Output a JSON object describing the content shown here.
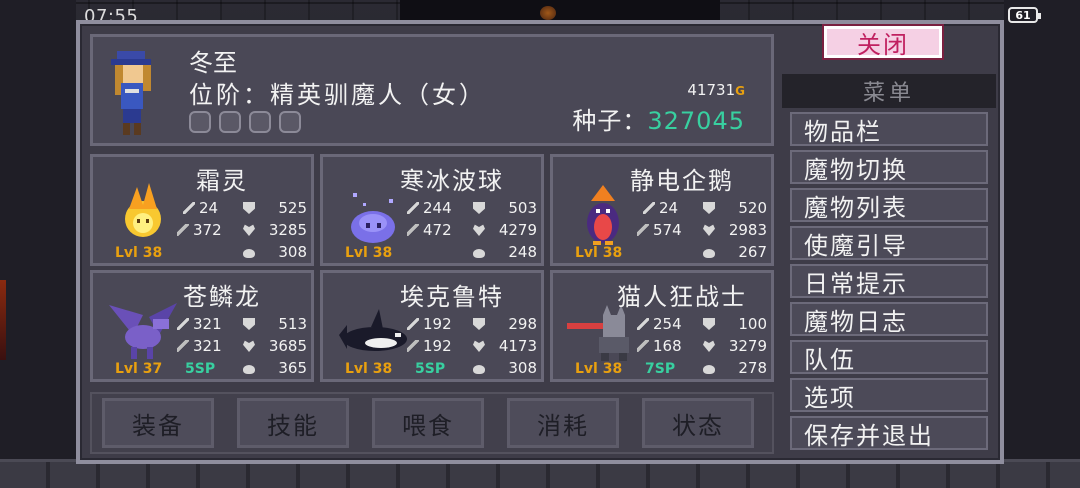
{
  "status_bar": {
    "time": "07:55",
    "battery": "61"
  },
  "hero": {
    "name": "冬至",
    "rank": "位阶：精英驯魔人（女）",
    "gold": "41731",
    "gold_unit": "G",
    "seed_label": "种子：",
    "seed_value": "327045"
  },
  "monsters": [
    {
      "name": "霜灵",
      "atk": "24",
      "def": "525",
      "mag": "372",
      "hp": "3285",
      "food": "308",
      "level": "Lvl 38",
      "sp": ""
    },
    {
      "name": "寒冰波球",
      "atk": "244",
      "def": "503",
      "mag": "472",
      "hp": "4279",
      "food": "248",
      "level": "Lvl 38",
      "sp": ""
    },
    {
      "name": "静电企鹅",
      "atk": "24",
      "def": "520",
      "mag": "574",
      "hp": "2983",
      "food": "267",
      "level": "Lvl 38",
      "sp": ""
    },
    {
      "name": "苍鳞龙",
      "atk": "321",
      "def": "513",
      "mag": "321",
      "hp": "3685",
      "food": "365",
      "level": "Lvl 37",
      "sp": "5SP"
    },
    {
      "name": "埃克鲁特",
      "atk": "192",
      "def": "298",
      "mag": "192",
      "hp": "4173",
      "food": "308",
      "level": "Lvl 38",
      "sp": "5SP"
    },
    {
      "name": "猫人狂战士",
      "atk": "254",
      "def": "100",
      "mag": "168",
      "hp": "3279",
      "food": "278",
      "level": "Lvl 38",
      "sp": "7SP"
    }
  ],
  "actions": [
    "装备",
    "技能",
    "喂食",
    "消耗",
    "状态"
  ],
  "menu": {
    "close_label": "关闭",
    "header": "菜单",
    "items": [
      "物品栏",
      "魔物切换",
      "魔物列表",
      "使魔引导",
      "日常提示",
      "魔物日志",
      "队伍",
      "选项",
      "保存并退出"
    ]
  },
  "colors": {
    "gold": "#e8a010",
    "seed": "#38d0a0",
    "close_text": "#c02060",
    "close_bg": "#f5d0e4"
  }
}
